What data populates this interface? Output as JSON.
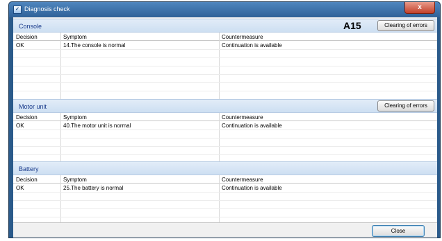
{
  "window": {
    "title": "Diagnosis check",
    "close_glyph": "x"
  },
  "columns": {
    "decision": "Decision",
    "symptom": "Symptom",
    "countermeasure": "Countermeasure"
  },
  "code_label": "A15",
  "sections": [
    {
      "title": "Console",
      "button": "Clearing of errors",
      "row": {
        "decision": "OK",
        "symptom": "14.The console is normal",
        "countermeasure": "Continuation is available"
      }
    },
    {
      "title": "Motor unit",
      "button": "Clearing of errors",
      "row": {
        "decision": "OK",
        "symptom": "40.The motor unit is normal",
        "countermeasure": "Continuation is available"
      }
    },
    {
      "title": "Battery",
      "row": {
        "decision": "OK",
        "symptom": "25.The battery is normal",
        "countermeasure": "Continuation is available"
      }
    }
  ],
  "footer": {
    "close_label": "Close"
  }
}
